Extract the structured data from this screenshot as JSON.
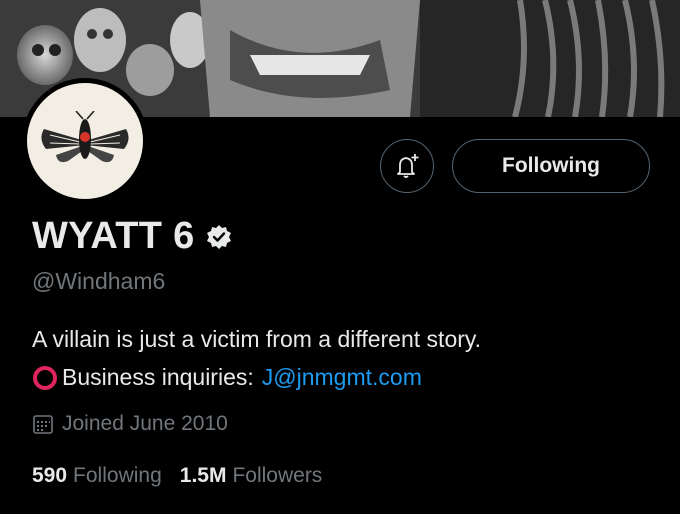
{
  "banner": {
    "icon": "banner-photo"
  },
  "avatar": {
    "icon": "moth-logo"
  },
  "actions": {
    "notify_icon": "bell-plus-icon",
    "follow_label": "Following"
  },
  "profile": {
    "name": "WYATT 6",
    "verified_icon": "verified-badge-icon",
    "handle": "@Windham6",
    "bio_line1": "A villain is just a victim from a different story.",
    "bio_line2_prefix": "Business inquiries:",
    "bio_email": "J@jnmgmt.com",
    "bio_emoji": "hollow-red-circle-icon",
    "joined": "Joined June 2010",
    "joined_icon": "calendar-icon"
  },
  "stats": {
    "following_count": "590",
    "following_label": "Following",
    "followers_count": "1.5M",
    "followers_label": "Followers"
  },
  "colors": {
    "background": "#000000",
    "text": "#e7e9ea",
    "muted": "#71767b",
    "link": "#1d9bf0",
    "border": "#536471",
    "emoji_red": "#e0245e"
  }
}
